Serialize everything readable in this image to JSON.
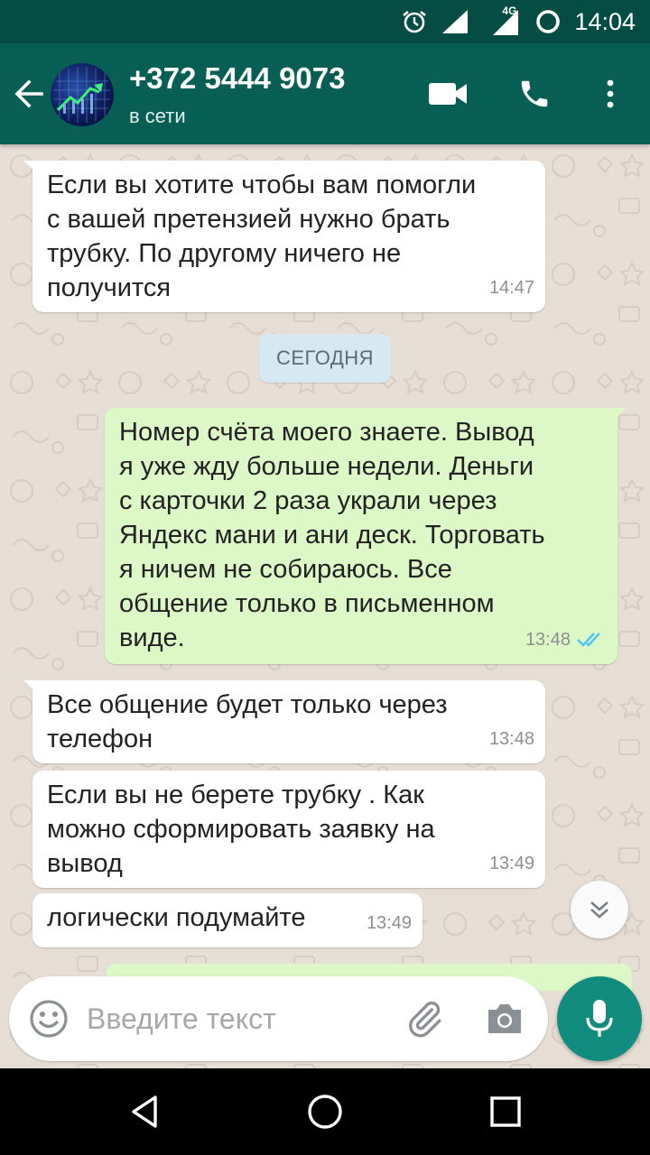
{
  "status_bar": {
    "time": "14:04",
    "network": "4G",
    "icons": [
      "alarm-icon",
      "wifi-signal-icon",
      "cell-signal-icon",
      "battery-icon"
    ]
  },
  "header": {
    "contact_name": "+372 5444 9073",
    "status": "в сети",
    "icons": [
      "back-arrow-icon",
      "video-call-icon",
      "phone-icon",
      "more-vert-icon"
    ]
  },
  "chat": {
    "date_separator": "СЕГОДНЯ",
    "messages": [
      {
        "direction": "in",
        "text": "Если вы хотите чтобы вам помогли\nс вашей претензией нужно брать\nтрубку. По другому ничего не\nполучится",
        "time": "14:47"
      },
      {
        "direction": "out",
        "text": "Номер счёта моего знаете. Вывод\nя уже жду больше недели. Деньги\nс карточки 2 раза украли через\nЯндекс мани и ани деск. Торговать\nя ничем не собираюсь. Все\nобщение только в письменном\nвиде.",
        "time": "13:48",
        "read": true
      },
      {
        "direction": "in",
        "text": "Все общение будет только через\nтелефон",
        "time": "13:48"
      },
      {
        "direction": "in",
        "text": "Если вы не берете трубку . Как\nможно сформировать заявку на\nвывод",
        "time": "13:49"
      },
      {
        "direction": "in",
        "text": "логически подумайте",
        "time": "13:49"
      }
    ]
  },
  "composer": {
    "placeholder": "Введите текст",
    "value": ""
  },
  "colors": {
    "status_bar": "#054d44",
    "app_bar": "#075e54",
    "chat_background": "#e6ddd4",
    "incoming_bubble": "#ffffff",
    "outgoing_bubble": "#dcf8c6",
    "accent": "#128c7e",
    "read_ticks": "#4fc3f7"
  }
}
